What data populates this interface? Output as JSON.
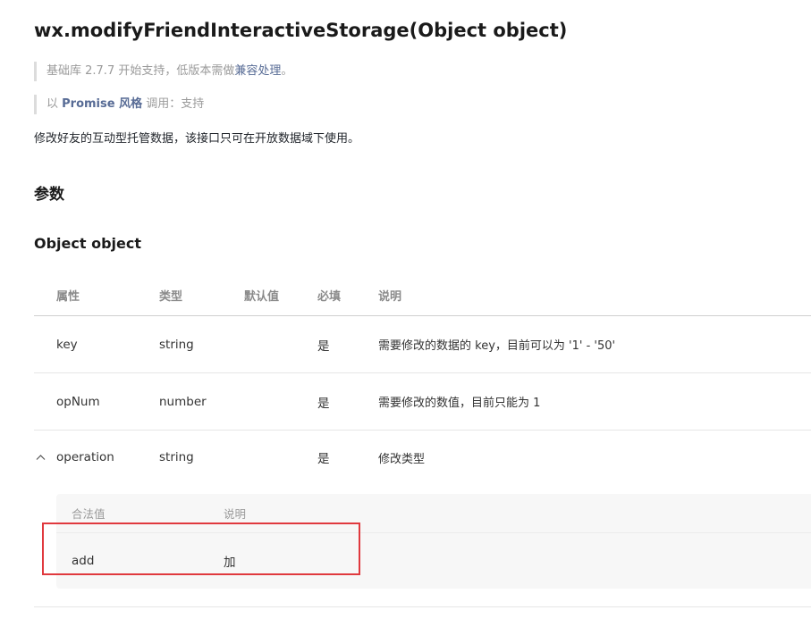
{
  "title": "wx.modifyFriendInteractiveStorage(Object object)",
  "notice_support": {
    "prefix": "基础库 2.7.7 开始支持，低版本需做",
    "link": "兼容处理",
    "suffix": "。"
  },
  "notice_promise": {
    "prefix": "以 ",
    "bold": "Promise 风格",
    "middle": " 调用：",
    "value": "支持"
  },
  "description": "修改好友的互动型托管数据，该接口只可在开放数据域下使用。",
  "section_params": "参数",
  "section_object": "Object object",
  "table": {
    "headers": {
      "name": "属性",
      "type": "类型",
      "default": "默认值",
      "required": "必填",
      "desc": "说明"
    },
    "rows": [
      {
        "name": "key",
        "type": "string",
        "default": "",
        "required": "是",
        "desc": "需要修改的数据的 key，目前可以为 '1' - '50'"
      },
      {
        "name": "opNum",
        "type": "number",
        "default": "",
        "required": "是",
        "desc": "需要修改的数值，目前只能为 1"
      },
      {
        "name": "operation",
        "type": "string",
        "default": "",
        "required": "是",
        "desc": "修改类型"
      }
    ]
  },
  "operation_values": {
    "headers": {
      "value": "合法值",
      "desc": "说明"
    },
    "rows": [
      {
        "value": "add",
        "desc": "加"
      }
    ]
  },
  "icons": {
    "expand": "chevron-up-icon"
  },
  "colors": {
    "link": "#576b95",
    "highlight": "#e0393e"
  }
}
